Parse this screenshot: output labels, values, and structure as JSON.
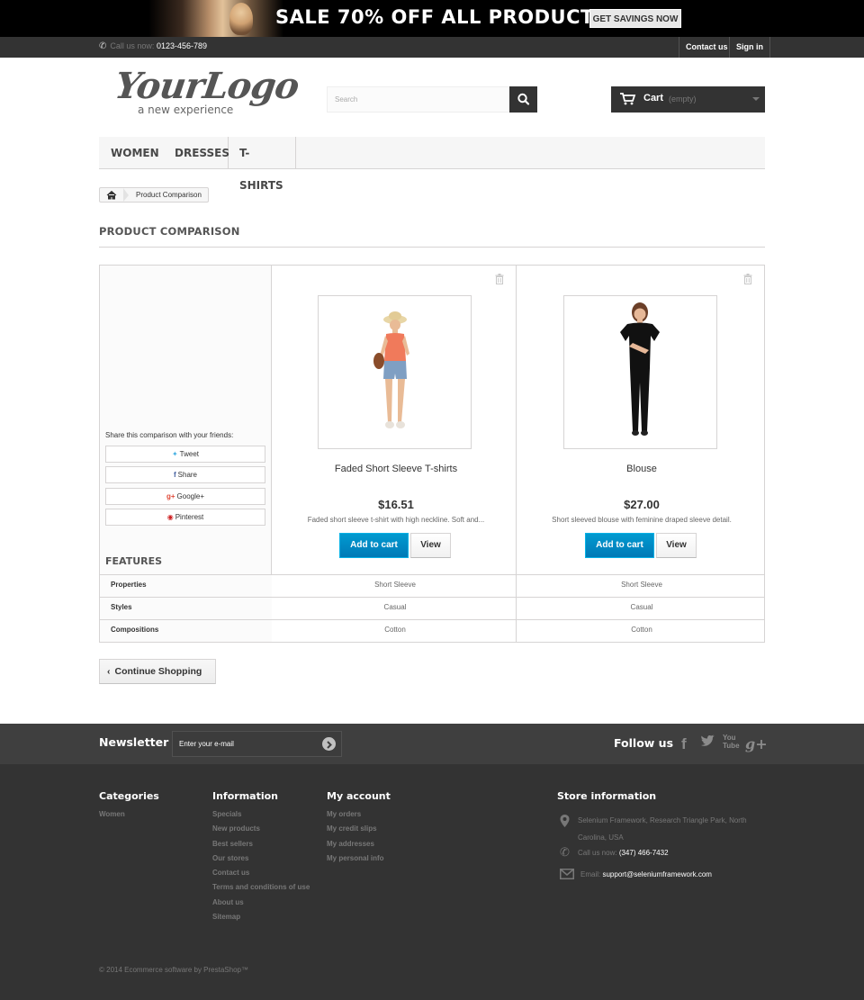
{
  "banner": {
    "headline": "SALE 70% OFF ALL PRODUCTS",
    "button": "GET SAVINGS NOW"
  },
  "topnav": {
    "call_prefix": "Call us now:",
    "phone": "0123-456-789",
    "contact": "Contact us",
    "signin": "Sign in"
  },
  "logo": {
    "main": "YourLogo",
    "tagline": "a new experience"
  },
  "search": {
    "placeholder": "Search"
  },
  "cart": {
    "label": "Cart",
    "status": "(empty)"
  },
  "menu": [
    "WOMEN",
    "DRESSES",
    "T-SHIRTS"
  ],
  "breadcrumb": {
    "current": "Product Comparison"
  },
  "page": {
    "title": "PRODUCT COMPARISON"
  },
  "share": {
    "title": "Share this comparison with your friends:",
    "tweet": "Tweet",
    "share": "Share",
    "google": "Google+",
    "pinterest": "Pinterest"
  },
  "features_title": "FEATURES",
  "products": [
    {
      "name": "Faded Short Sleeve T-shirts",
      "price": "$16.51",
      "desc": "Faded short sleeve t-shirt with high neckline. Soft and...",
      "add_to_cart": "Add to cart",
      "view": "View"
    },
    {
      "name": "Blouse",
      "price": "$27.00",
      "desc": "Short sleeved blouse with feminine draped sleeve detail.",
      "add_to_cart": "Add to cart",
      "view": "View"
    }
  ],
  "features": [
    {
      "name": "Properties",
      "values": [
        "Short Sleeve",
        "Short Sleeve"
      ]
    },
    {
      "name": "Styles",
      "values": [
        "Casual",
        "Casual"
      ]
    },
    {
      "name": "Compositions",
      "values": [
        "Cotton",
        "Cotton"
      ]
    }
  ],
  "continue_shopping": "Continue Shopping",
  "footer": {
    "newsletter_title": "Newsletter",
    "newsletter_placeholder": "Enter your e-mail",
    "follow_title": "Follow us",
    "categories": {
      "title": "Categories",
      "items": [
        "Women"
      ]
    },
    "information": {
      "title": "Information",
      "items": [
        "Specials",
        "New products",
        "Best sellers",
        "Our stores",
        "Contact us",
        "Terms and conditions of use",
        "About us",
        "Sitemap"
      ]
    },
    "account": {
      "title": "My account",
      "items": [
        "My orders",
        "My credit slips",
        "My addresses",
        "My personal info"
      ]
    },
    "store": {
      "title": "Store information",
      "address": "Selenium Framework, Research Triangle Park, North Carolina, USA",
      "phone_prefix": "Call us now:",
      "phone": "(347) 466-7432",
      "email_prefix": "Email:",
      "email": "support@seleniumframework.com"
    },
    "copyright": "© 2014 Ecommerce software by PrestaShop™"
  },
  "colors": {
    "accent": "#009ad0",
    "dark": "#333333",
    "footer_top": "#3f3f3f"
  }
}
